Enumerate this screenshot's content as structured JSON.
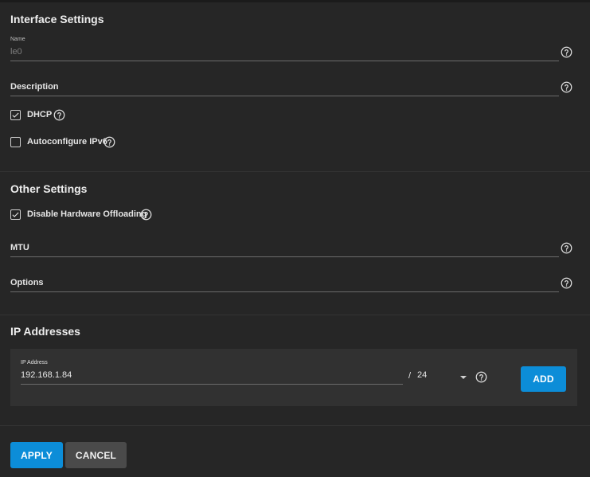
{
  "interface_settings": {
    "title": "Interface Settings",
    "name_label": "Name",
    "name_value": "le0",
    "description_label": "Description",
    "dhcp_label": "DHCP",
    "dhcp_checked": true,
    "autoconf_label": "Autoconfigure IPv6",
    "autoconf_checked": false
  },
  "other_settings": {
    "title": "Other Settings",
    "disable_offload_label": "Disable Hardware Offloading",
    "disable_offload_checked": true,
    "mtu_label": "MTU",
    "options_label": "Options"
  },
  "ip_addresses": {
    "title": "IP Addresses",
    "ip_label": "IP Address",
    "ip_value": "192.168.1.84",
    "slash": "/",
    "netmask_value": "24",
    "add_label": "ADD"
  },
  "actions": {
    "apply_label": "APPLY",
    "cancel_label": "CANCEL"
  },
  "colors": {
    "background": "#262626",
    "primary": "#0c8dd8",
    "secondary": "#4a4a4a"
  },
  "icons": [
    "help-circle-icon",
    "check-icon",
    "chevron-down-icon"
  ]
}
